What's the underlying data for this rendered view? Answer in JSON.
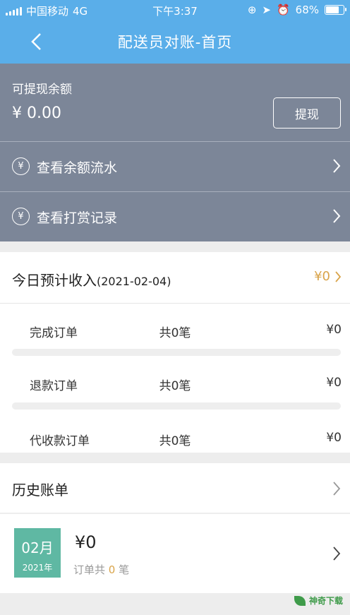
{
  "status_bar": {
    "carrier": "中国移动",
    "network": "4G",
    "time": "下午3:37",
    "battery": "68%",
    "battery_level": 0.68
  },
  "nav": {
    "title": "配送员对账-首页"
  },
  "balance": {
    "label": "可提现余额",
    "amount": "¥ 0.00",
    "withdraw_label": "提现"
  },
  "menu": [
    {
      "icon": "yen-circle-icon",
      "label": "查看余额流水"
    },
    {
      "icon": "yen-circle-icon",
      "label": "查看打赏记录"
    }
  ],
  "today": {
    "title": "今日预计收入",
    "date": "(2021-02-04)",
    "amount": "¥0",
    "rows": [
      {
        "name": "完成订单",
        "count": "共0笔",
        "amount": "¥0"
      },
      {
        "name": "退款订单",
        "count": "共0笔",
        "amount": "¥0"
      },
      {
        "name": "代收款订单",
        "count": "共0笔",
        "amount": "¥0"
      }
    ]
  },
  "history": {
    "title": "历史账单",
    "bills": [
      {
        "month": "02月",
        "year": "2021年",
        "amount": "¥0",
        "count_prefix": "订单共",
        "count": "0",
        "count_suffix": "笔"
      }
    ]
  },
  "watermark": "神奇下载",
  "colors": {
    "header": "#5aaee9",
    "panel": "#7c8698",
    "accent_gold": "#d9a44a",
    "date_badge": "#5fb8a3"
  }
}
